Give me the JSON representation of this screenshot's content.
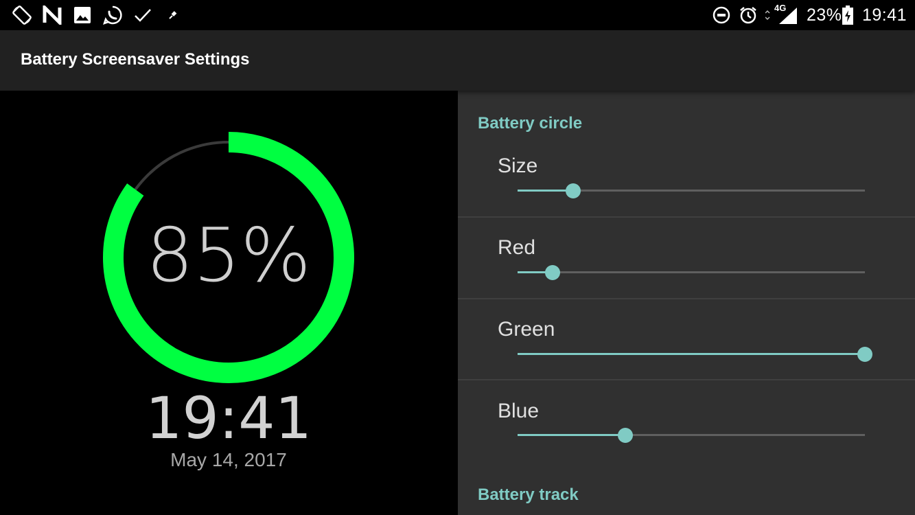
{
  "status_bar": {
    "left_icons": [
      "screen-rotation-icon",
      "n-app-icon",
      "image-icon",
      "whatsapp-icon",
      "check-icon",
      "pin-icon"
    ],
    "right_icons": [
      "do-not-disturb-icon",
      "alarm-icon",
      "signal-4g-icon",
      "battery-charging-icon"
    ],
    "network": "4G",
    "battery_percent": "23%",
    "time": "19:41"
  },
  "app_bar": {
    "title": "Battery Screensaver Settings"
  },
  "preview": {
    "battery_level": 0.85,
    "percent_text": "85%",
    "time": "19:41",
    "date": "May 14, 2017",
    "ring_color": "#00ff41",
    "track_color": "#3a3a3a"
  },
  "settings": {
    "accent_color": "#80cbc4",
    "section_battery_circle": "Battery circle",
    "prefs": [
      {
        "title": "Size",
        "value": 0.16
      },
      {
        "title": "Red",
        "value": 0.1
      },
      {
        "title": "Green",
        "value": 1.0
      },
      {
        "title": "Blue",
        "value": 0.31
      }
    ],
    "section_battery_track": "Battery track"
  }
}
